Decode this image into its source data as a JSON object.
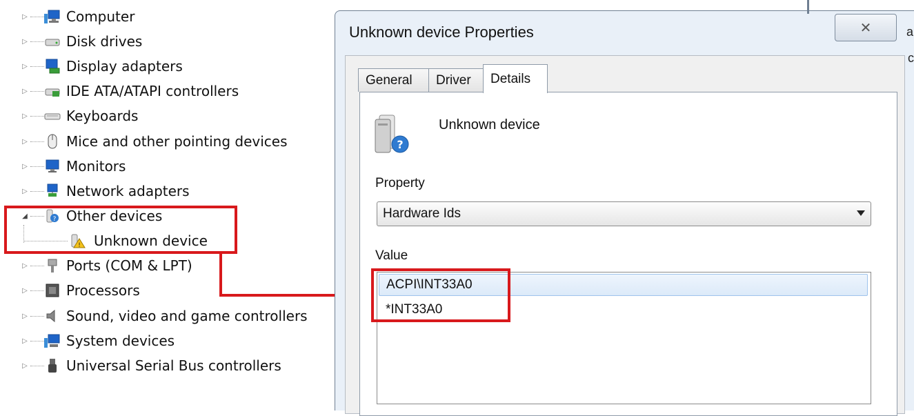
{
  "device_tree": {
    "items": [
      {
        "label": "Computer",
        "icon": "computer-icon",
        "expanded": false
      },
      {
        "label": "Disk drives",
        "icon": "disk-drive-icon",
        "expanded": false
      },
      {
        "label": "Display adapters",
        "icon": "display-adapter-icon",
        "expanded": false
      },
      {
        "label": "IDE ATA/ATAPI controllers",
        "icon": "ide-controller-icon",
        "expanded": false
      },
      {
        "label": "Keyboards",
        "icon": "keyboard-icon",
        "expanded": false
      },
      {
        "label": "Mice and other pointing devices",
        "icon": "mouse-icon",
        "expanded": false
      },
      {
        "label": "Monitors",
        "icon": "monitor-icon",
        "expanded": false
      },
      {
        "label": "Network adapters",
        "icon": "network-adapter-icon",
        "expanded": false
      },
      {
        "label": "Other devices",
        "icon": "other-devices-icon",
        "expanded": true
      },
      {
        "label": "Unknown device",
        "icon": "unknown-device-warning-icon",
        "child": true
      },
      {
        "label": "Ports (COM & LPT)",
        "icon": "port-icon",
        "expanded": false
      },
      {
        "label": "Processors",
        "icon": "processor-icon",
        "expanded": false
      },
      {
        "label": "Sound, video and game controllers",
        "icon": "speaker-icon",
        "expanded": false
      },
      {
        "label": "System devices",
        "icon": "system-device-icon",
        "expanded": false
      },
      {
        "label": "Universal Serial Bus controllers",
        "icon": "usb-icon",
        "expanded": false
      }
    ]
  },
  "dialog": {
    "title": "Unknown device Properties",
    "close_glyph": "✕",
    "tabs": [
      {
        "label": "General",
        "active": false
      },
      {
        "label": "Driver",
        "active": false
      },
      {
        "label": "Details",
        "active": true
      }
    ],
    "device_name": "Unknown device",
    "property_label": "Property",
    "property_value": "Hardware Ids",
    "value_label": "Value",
    "values": [
      "ACPI\\INT33A0",
      "*INT33A0"
    ],
    "selected_value_index": 0
  },
  "background_window": {
    "partial_chars": [
      "a",
      "c"
    ]
  },
  "colors": {
    "highlight": "#d8191c",
    "dialog_frame": "#e9f0f8",
    "selection": "#dceaf9"
  }
}
